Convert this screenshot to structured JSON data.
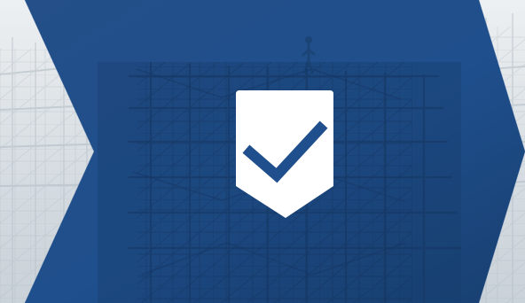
{
  "image": {
    "subject": "construction-scaffolding-photo",
    "overlay_shape": "chevron-arrow",
    "badge_icon": "checkmark-shield-icon",
    "colors": {
      "overlay": "#1f4f8d",
      "overlay_dark": "#18406f",
      "background_photo": "#d7dde2",
      "badge_fill": "#ffffff",
      "check_stroke": "#1f4f8d"
    }
  }
}
